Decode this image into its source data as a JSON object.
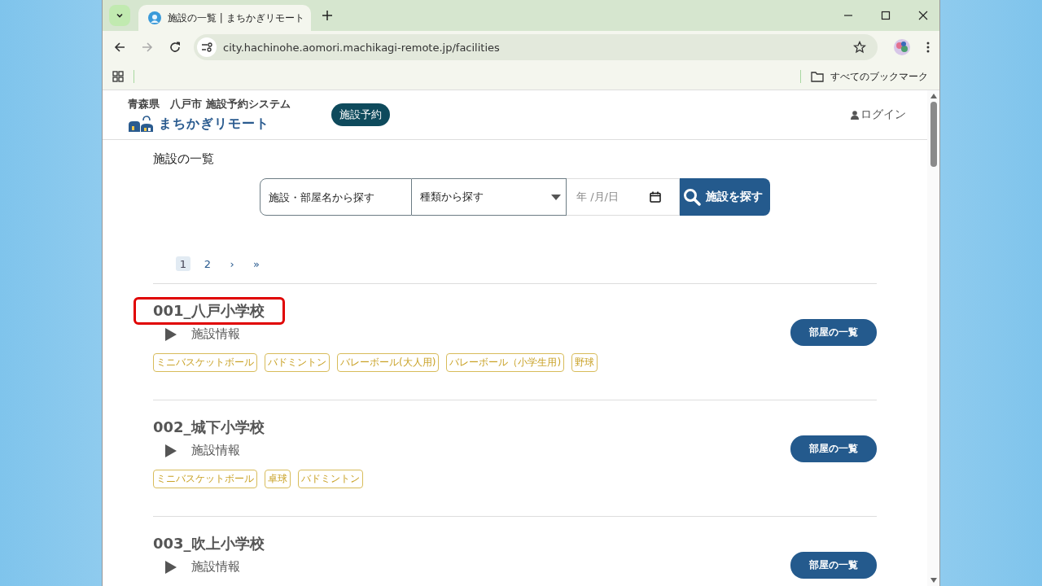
{
  "browser": {
    "tab_title": "施設の一覧 | まちかぎリモート",
    "url": "city.hachinohe.aomori.machikagi-remote.jp/facilities",
    "bookmarks_label": "すべてのブックマーク"
  },
  "header": {
    "region": "青森県　八戸市 施設予約システム",
    "logo_text": "まちかぎリモート",
    "nav_button": "施設予約",
    "login": "ログイン"
  },
  "page_title": "施設の一覧",
  "search": {
    "name_placeholder": "施設・部屋名から探す",
    "type_value": "種類から探す",
    "date_placeholder": "年 /月/日",
    "button": "施設を探す"
  },
  "pagination": [
    {
      "label": "1",
      "selected": true
    },
    {
      "label": "2",
      "selected": false
    },
    {
      "label": "›",
      "selected": false
    },
    {
      "label": "»",
      "selected": false
    }
  ],
  "facilities": [
    {
      "name": "001_八戸小学校",
      "highlighted": true,
      "info": "施設情報",
      "tags": [
        "ミニバスケットボール",
        "バドミントン",
        "バレーボール(大人用)",
        "バレーボール（小学生用)",
        "野球"
      ],
      "button": "部屋の一覧"
    },
    {
      "name": "002_城下小学校",
      "highlighted": false,
      "info": "施設情報",
      "tags": [
        "ミニバスケットボール",
        "卓球",
        "バドミントン"
      ],
      "button": "部屋の一覧"
    },
    {
      "name": "003_吹上小学校",
      "highlighted": false,
      "info": "施設情報",
      "button": "部屋の一覧"
    }
  ]
}
